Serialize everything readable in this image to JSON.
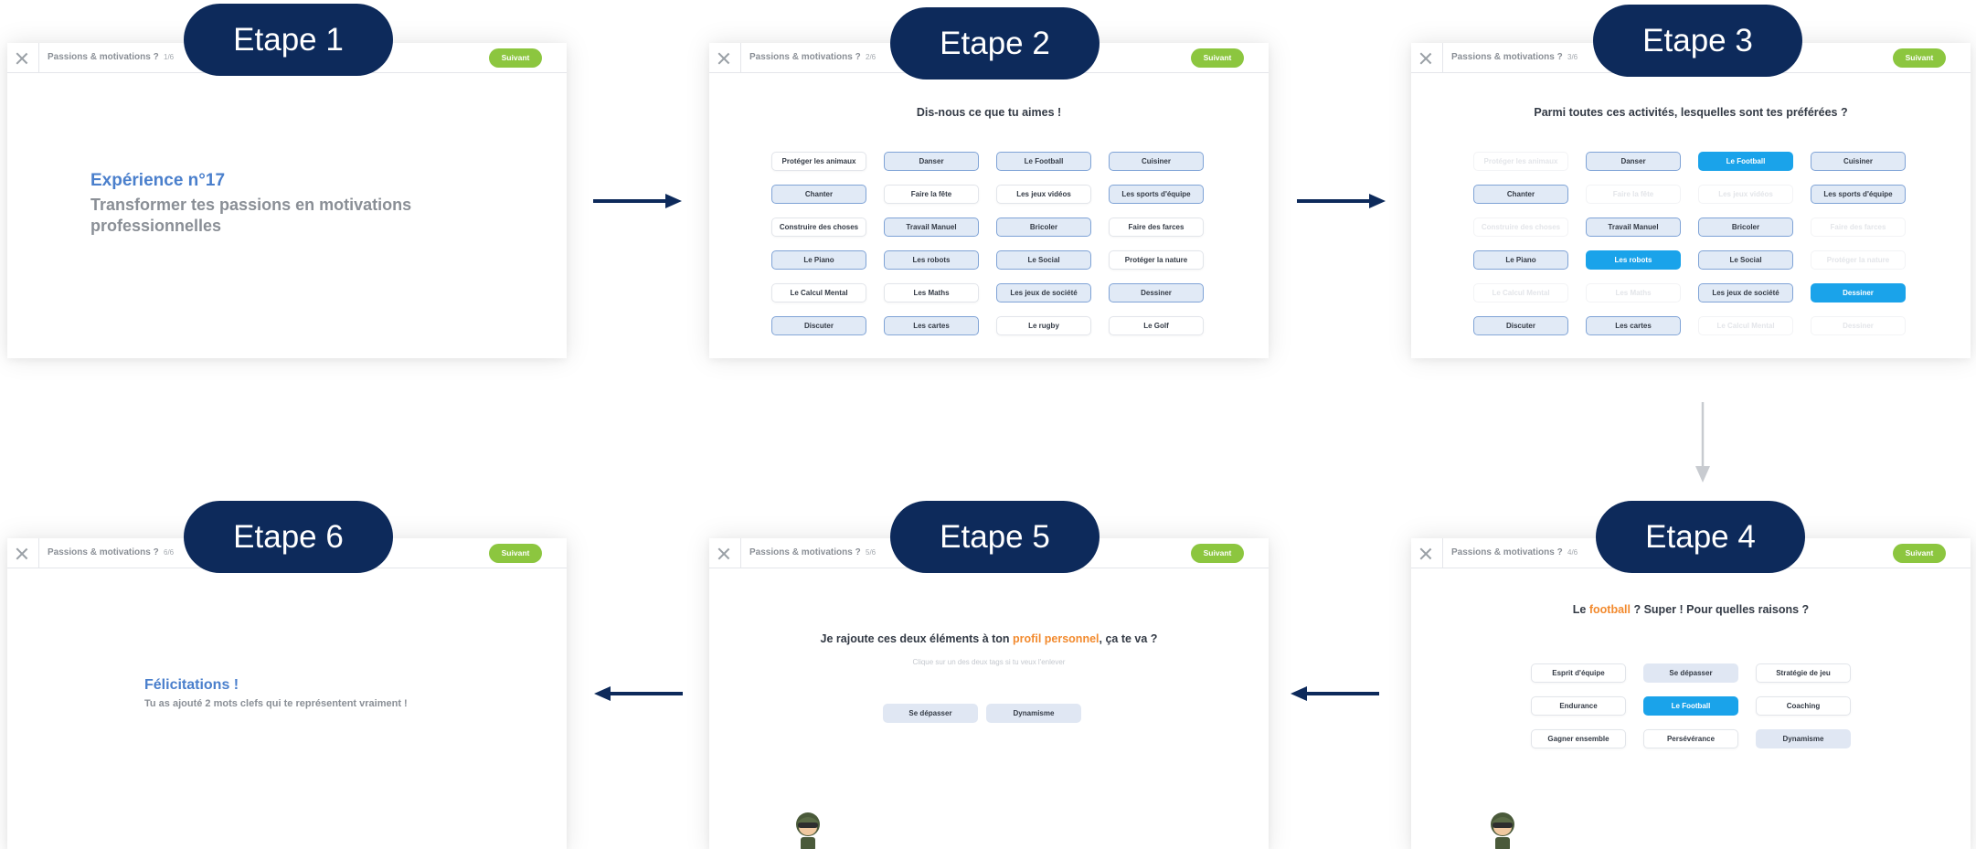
{
  "steps": [
    "Etape 1",
    "Etape 2",
    "Etape 3",
    "Etape 4",
    "Etape 5",
    "Etape 6"
  ],
  "header": {
    "title": "Passions & motivations ?",
    "next_label": "Suivant",
    "next_color": "#8cc63f",
    "counters": [
      "1/6",
      "2/6",
      "3/6",
      "4/6",
      "5/6",
      "6/6"
    ]
  },
  "screen1": {
    "experience": "Expérience n°17",
    "description": "Transformer tes passions en motivations professionnelles"
  },
  "screen2": {
    "question": "Dis-nous ce que tu aimes !",
    "chips": [
      {
        "label": "Protéger les animaux"
      },
      {
        "label": "Danser"
      },
      {
        "label": "Le Football"
      },
      {
        "label": "Cuisiner"
      },
      {
        "label": "Chanter"
      },
      {
        "label": "Faire la fête"
      },
      {
        "label": "Les jeux vidéos"
      },
      {
        "label": "Les sports d'équipe"
      },
      {
        "label": "Construire des choses"
      },
      {
        "label": "Travail Manuel"
      },
      {
        "label": "Bricoler"
      },
      {
        "label": "Faire des farces"
      },
      {
        "label": "Le Piano"
      },
      {
        "label": "Les robots"
      },
      {
        "label": "Le Social"
      },
      {
        "label": "Protéger la nature"
      },
      {
        "label": "Le Calcul Mental"
      },
      {
        "label": "Les Maths"
      },
      {
        "label": "Les jeux de société"
      },
      {
        "label": "Dessiner"
      },
      {
        "label": "Discuter"
      },
      {
        "label": "Les cartes"
      },
      {
        "label": "Le rugby"
      },
      {
        "label": "Le Golf"
      }
    ]
  },
  "screen3": {
    "question": "Parmi toutes ces activités, lesquelles sont tes préférées ?",
    "chips": [
      {
        "label": "Protéger les animaux"
      },
      {
        "label": "Danser"
      },
      {
        "label": "Le Football"
      },
      {
        "label": "Cuisiner"
      },
      {
        "label": "Chanter"
      },
      {
        "label": "Faire la fête"
      },
      {
        "label": "Les jeux vidéos"
      },
      {
        "label": "Les sports d'équipe"
      },
      {
        "label": "Construire des choses"
      },
      {
        "label": "Travail Manuel"
      },
      {
        "label": "Bricoler"
      },
      {
        "label": "Faire des farces"
      },
      {
        "label": "Le Piano"
      },
      {
        "label": "Les robots"
      },
      {
        "label": "Le Social"
      },
      {
        "label": "Protéger la nature"
      },
      {
        "label": "Le Calcul Mental"
      },
      {
        "label": "Les Maths"
      },
      {
        "label": "Les jeux de société"
      },
      {
        "label": "Dessiner"
      },
      {
        "label": "Discuter"
      },
      {
        "label": "Les cartes"
      },
      {
        "label": "Le Calcul Mental"
      },
      {
        "label": "Dessiner"
      }
    ]
  },
  "screen4": {
    "question_prefix": "Le ",
    "question_highlight": "football",
    "question_suffix": " ? Super ! Pour quelles raisons ?",
    "reasons": [
      "Esprit d'équipe",
      "Se dépasser",
      "Stratégie de jeu",
      "Endurance",
      "Le Football",
      "Coaching",
      "Gagner ensemble",
      "Persévérance",
      "Dynamisme"
    ]
  },
  "screen5": {
    "question_prefix": "Je rajoute ces deux éléments à ton ",
    "question_highlight": "profil personnel",
    "question_suffix": ", ça te va ?",
    "hint": "Clique sur un des deux tags si tu veux l'enlever",
    "tags": [
      "Se dépasser",
      "Dynamisme"
    ]
  },
  "screen6": {
    "title": "Félicitations !",
    "subtitle": "Tu as ajouté 2 mots clefs qui te représentent vraiment !"
  },
  "colors": {
    "badge": "#0d2a5b",
    "selected_chip": "#e1eaf6",
    "highlight_chip": "#1aa3ea",
    "accent_title": "#4a7fcc",
    "highlight_text": "#f28a2e"
  }
}
